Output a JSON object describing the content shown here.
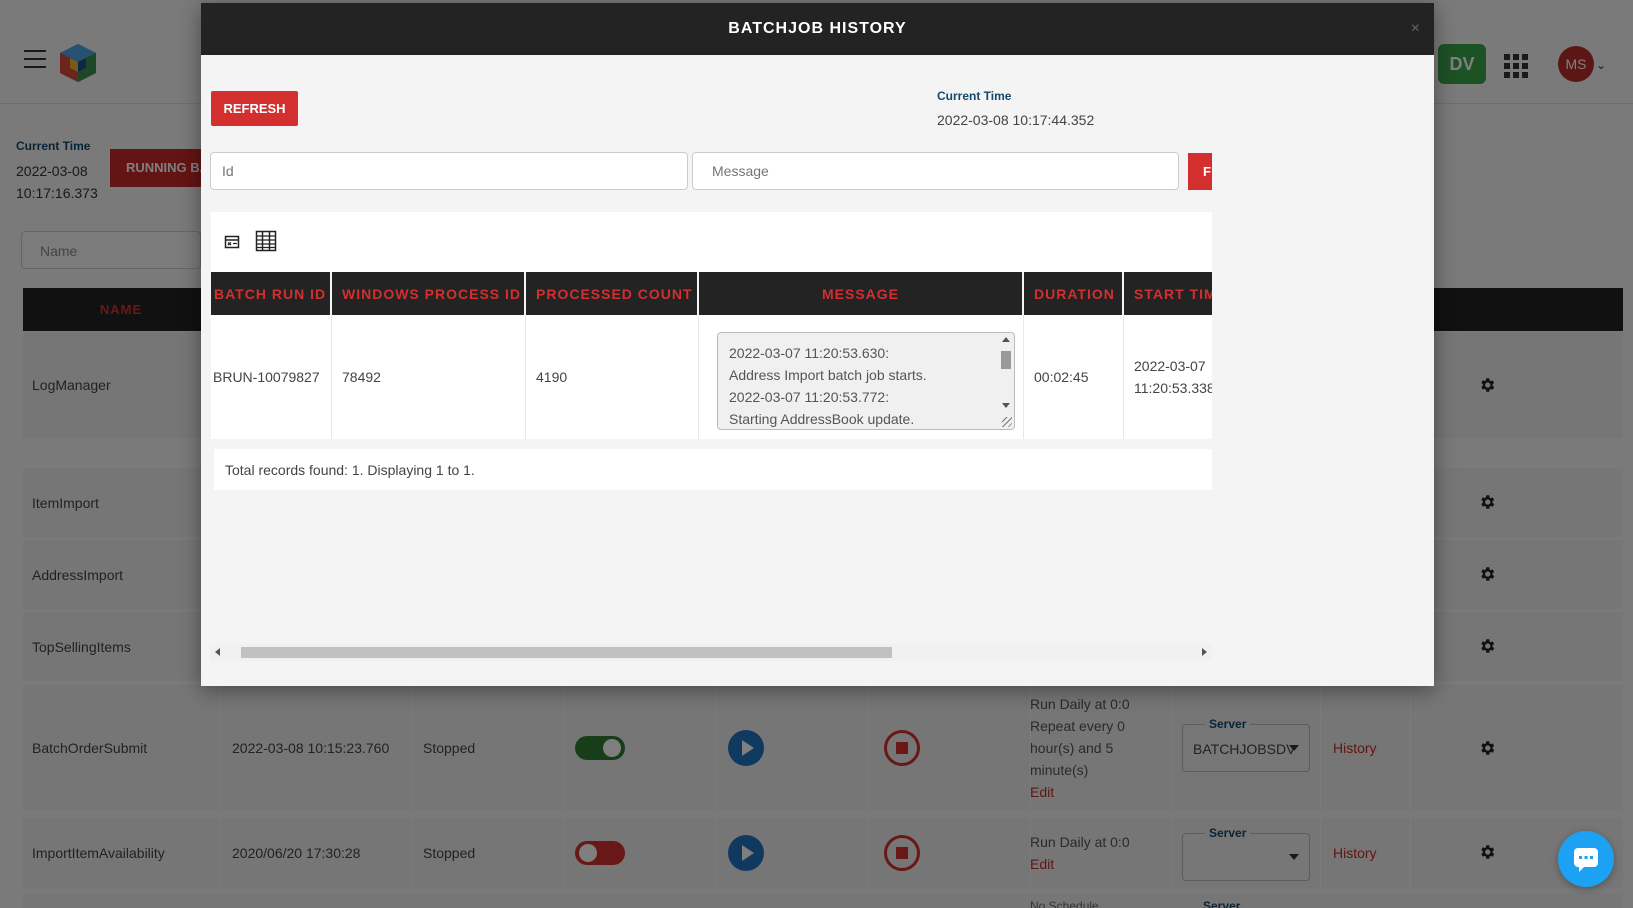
{
  "background": {
    "user_initials": "MS",
    "env_badge": "DV",
    "current_time_label": "Current Time",
    "current_time_value": "2022-03-08 10:17:16.373",
    "running_button": "RUNNING BA",
    "name_placeholder": "Name",
    "table_header_name": "NAME",
    "rows": [
      {
        "name": "LogManager"
      },
      {
        "name": "ItemImport"
      },
      {
        "name": "AddressImport"
      },
      {
        "name": "TopSellingItems"
      },
      {
        "name": "BatchOrderSubmit",
        "last_run": "2022-03-08 10:15:23.760",
        "status": "Stopped",
        "enabled": true,
        "schedule_line1": "Run Daily at 0:0",
        "schedule_line2": "Repeat every 0",
        "schedule_line3": "hour(s) and 5",
        "schedule_line4": "minute(s)",
        "edit": "Edit",
        "server_label": "Server",
        "server_value": "BATCHJOBSDV",
        "history": "History"
      },
      {
        "name": "ImportItemAvailability",
        "last_run": "2020/06/20 17:30:28",
        "status": "Stopped",
        "enabled": false,
        "schedule_line1": "Run Daily at 0:0",
        "edit": "Edit",
        "server_label": "Server",
        "server_value": "",
        "history": "History"
      }
    ],
    "partial_row_server_label": "Server",
    "partial_row_schedule": "No Schedule"
  },
  "modal": {
    "title": "BATCHJOB HISTORY",
    "close_glyph": "×",
    "refresh_label": "REFRESH",
    "current_time_label": "Current Time",
    "current_time_value": "2022-03-08 10:17:44.352",
    "id_placeholder": "Id",
    "message_placeholder": "Message",
    "filter_button_label": "F",
    "columns": [
      "BATCH RUN ID",
      "WINDOWS PROCESS ID",
      "PROCESSED COUNT",
      "MESSAGE",
      "DURATION",
      "START TIME"
    ],
    "rows": [
      {
        "batch_run_id": "BRUN-10079827",
        "windows_process_id": "78492",
        "processed_count": "4190",
        "message": "2022-03-07 11:20:53.630:\nAddress Import batch job starts.\n2022-03-07 11:20:53.772:\nStarting AddressBook update.",
        "duration": "00:02:45",
        "start_time_line1": "2022-03-07",
        "start_time_line2": "11:20:53.338"
      }
    ],
    "footer_text": "Total records found: 1. Displaying 1 to 1."
  }
}
